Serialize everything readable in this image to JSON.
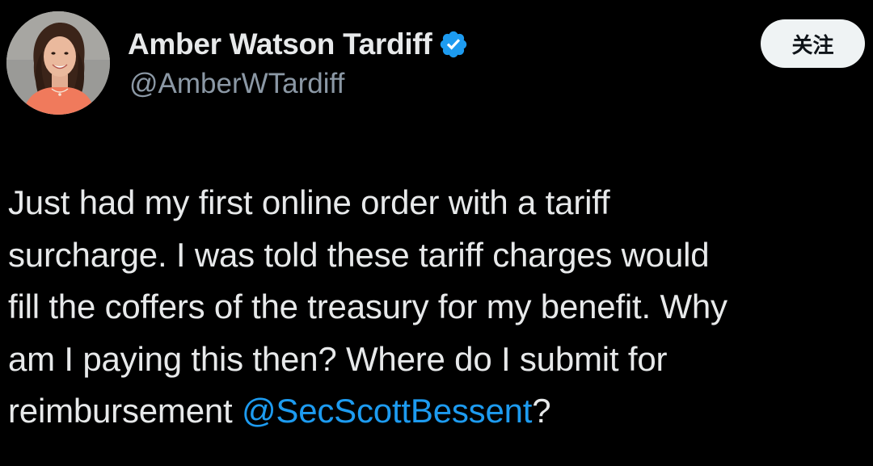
{
  "author": {
    "display_name": "Amber Watson Tardiff",
    "handle": "@AmberWTardiff",
    "avatar_icon": "profile-photo",
    "verified_icon": "verified-badge-icon"
  },
  "follow_button": {
    "label": "关注"
  },
  "tweet": {
    "lines": [
      "Just had my first online order with a tariff",
      "surcharge. I was told these tariff charges would",
      "fill the coffers of the treasury for my benefit. Why",
      "am I paying this then? Where do I submit for"
    ],
    "last_line_prefix": "reimbursement ",
    "mention": "@SecScottBessent",
    "last_line_suffix": "?"
  },
  "colors": {
    "background": "#000000",
    "text": "#e7e9ea",
    "secondary_text": "#8b98a5",
    "accent": "#1d9bf0",
    "button_bg": "#eff3f4"
  }
}
